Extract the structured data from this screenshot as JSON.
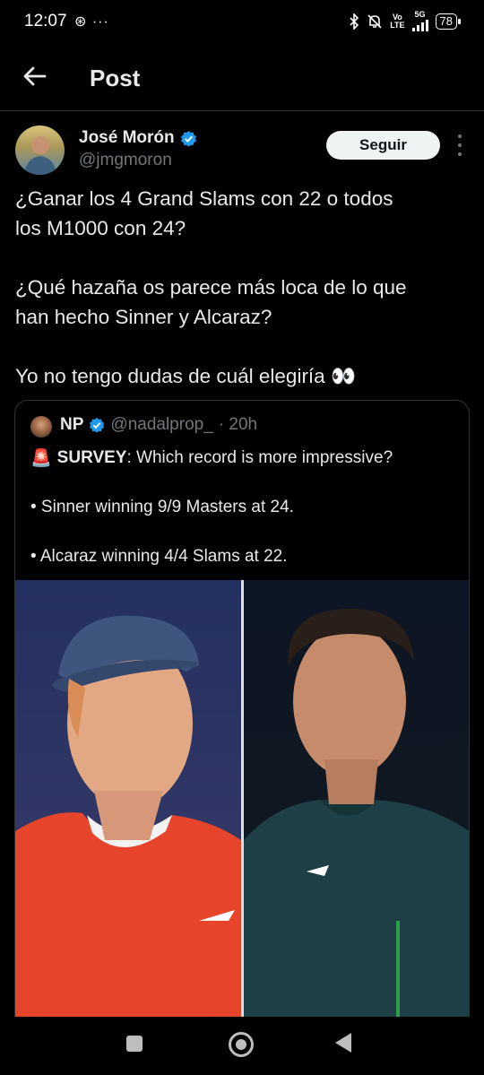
{
  "status_bar": {
    "time": "12:07",
    "left_icons": "⊛ ···",
    "network_top": "Vo",
    "network_bottom": "LTE",
    "network_type": "5G",
    "battery": "78"
  },
  "header": {
    "title": "Post"
  },
  "author": {
    "name": "José Morón",
    "handle": "@jmgmoron",
    "follow_label": "Seguir"
  },
  "tweet": {
    "line1": "¿Ganar los 4 Grand Slams con 22 o todos",
    "line2": "los M1000 con 24?",
    "line3": "¿Qué hazaña os parece más loca de lo que",
    "line4": "han hecho Sinner y Alcaraz?",
    "line5": "Yo no tengo dudas de cuál elegiría 👀"
  },
  "quoted": {
    "name": "NP",
    "handle": "@nadalprop_",
    "time": "· 20h",
    "emoji": "🚨",
    "lead": "SURVEY",
    "question": ": Which record is more impressive?",
    "bullet1": "• Sinner winning 9/9 Masters at 24.",
    "bullet2": "• Alcaraz winning 4/4 Slams at 22."
  },
  "colors": {
    "background": "#000000",
    "text": "#e7e9ea",
    "muted": "#71767b",
    "verified": "#1d9bf0",
    "border": "#2f3336"
  },
  "icons": {
    "back": "back-arrow-icon",
    "verified": "verified-badge-icon",
    "more": "more-options-icon"
  }
}
